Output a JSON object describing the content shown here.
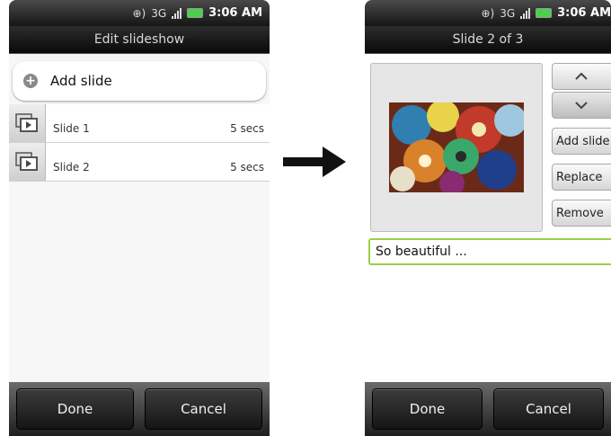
{
  "status": {
    "time": "3:06 AM",
    "network": "3G"
  },
  "screen_a": {
    "title": "Edit slideshow",
    "add_slide_label": "Add slide",
    "slides": [
      {
        "name": "Slide 1",
        "duration": "5 secs"
      },
      {
        "name": "Slide 2",
        "duration": "5 secs"
      }
    ],
    "done_label": "Done",
    "cancel_label": "Cancel"
  },
  "screen_b": {
    "title": "Slide 2 of 3",
    "up_glyph": "^",
    "add_slide_label": "Add slide",
    "replace_label": "Replace",
    "remove_label": "Remove",
    "caption_value": "So beautiful ...",
    "done_label": "Done",
    "cancel_label": "Cancel"
  },
  "colors": {
    "caption_border": "#9ad04b",
    "battery": "#4bd04b"
  }
}
